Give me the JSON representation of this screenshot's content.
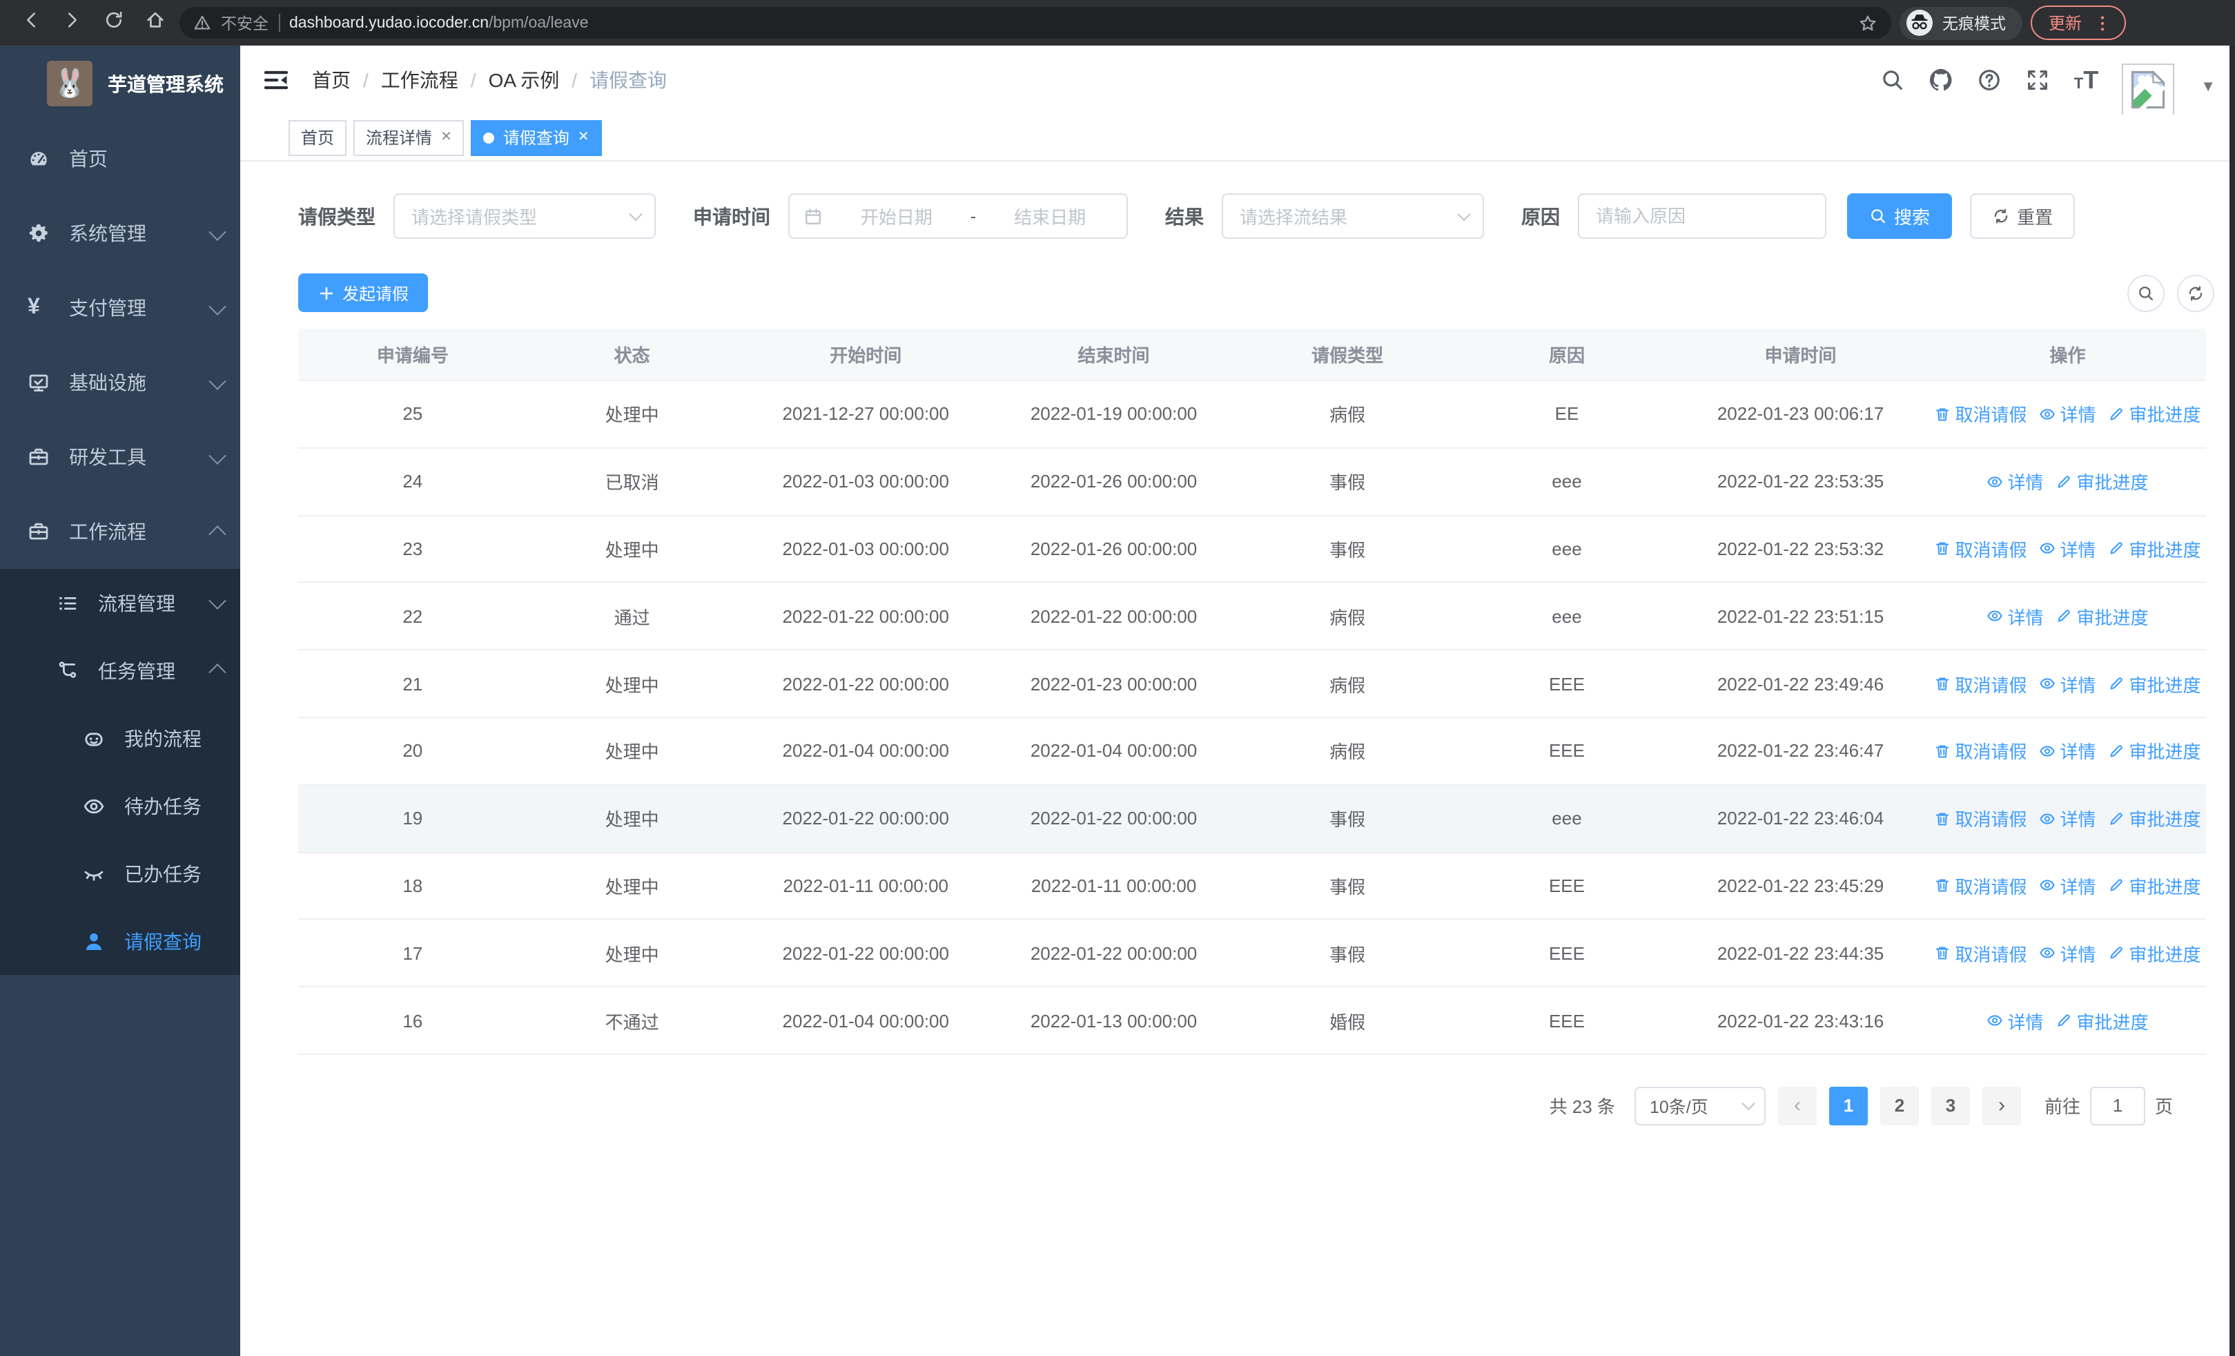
{
  "browser": {
    "security_label": "不安全",
    "url_host": "dashboard.yudao.iocoder.cn",
    "url_path": "/bpm/oa/leave",
    "incognito_label": "无痕模式",
    "update_label": "更新"
  },
  "sidebar": {
    "logo_title": "芋道管理系统",
    "menu": [
      {
        "label": "首页"
      },
      {
        "label": "系统管理"
      },
      {
        "label": "支付管理"
      },
      {
        "label": "基础设施"
      },
      {
        "label": "研发工具"
      },
      {
        "label": "工作流程"
      }
    ],
    "submenu": [
      {
        "label": "流程管理"
      },
      {
        "label": "任务管理"
      }
    ],
    "task_children": [
      {
        "label": "我的流程"
      },
      {
        "label": "待办任务"
      },
      {
        "label": "已办任务"
      },
      {
        "label": "请假查询"
      }
    ]
  },
  "navbar": {
    "breadcrumb": [
      "首页",
      "工作流程",
      "OA 示例",
      "请假查询"
    ]
  },
  "tags": [
    {
      "label": "首页"
    },
    {
      "label": "流程详情"
    },
    {
      "label": "请假查询"
    }
  ],
  "filters": {
    "leave_type_label": "请假类型",
    "leave_type_placeholder": "请选择请假类型",
    "apply_time_label": "申请时间",
    "date_start_placeholder": "开始日期",
    "date_separator": "-",
    "date_end_placeholder": "结束日期",
    "result_label": "结果",
    "result_placeholder": "请选择流结果",
    "reason_label": "原因",
    "reason_placeholder": "请输入原因",
    "search_label": "搜索",
    "reset_label": "重置",
    "create_label": "发起请假"
  },
  "table": {
    "headers": [
      "申请编号",
      "状态",
      "开始时间",
      "结束时间",
      "请假类型",
      "原因",
      "申请时间",
      "操作"
    ],
    "action_labels": {
      "cancel": "取消请假",
      "detail": "详情",
      "progress": "审批进度"
    },
    "rows": [
      {
        "id": "25",
        "status": "处理中",
        "start": "2021-12-27 00:00:00",
        "end": "2022-01-19 00:00:00",
        "type": "病假",
        "reason": "EE",
        "apply_time": "2022-01-23 00:06:17",
        "actions": [
          "cancel",
          "detail",
          "progress"
        ]
      },
      {
        "id": "24",
        "status": "已取消",
        "start": "2022-01-03 00:00:00",
        "end": "2022-01-26 00:00:00",
        "type": "事假",
        "reason": "eee",
        "apply_time": "2022-01-22 23:53:35",
        "actions": [
          "detail",
          "progress"
        ]
      },
      {
        "id": "23",
        "status": "处理中",
        "start": "2022-01-03 00:00:00",
        "end": "2022-01-26 00:00:00",
        "type": "事假",
        "reason": "eee",
        "apply_time": "2022-01-22 23:53:32",
        "actions": [
          "cancel",
          "detail",
          "progress"
        ]
      },
      {
        "id": "22",
        "status": "通过",
        "start": "2022-01-22 00:00:00",
        "end": "2022-01-22 00:00:00",
        "type": "病假",
        "reason": "eee",
        "apply_time": "2022-01-22 23:51:15",
        "actions": [
          "detail",
          "progress"
        ]
      },
      {
        "id": "21",
        "status": "处理中",
        "start": "2022-01-22 00:00:00",
        "end": "2022-01-23 00:00:00",
        "type": "病假",
        "reason": "EEE",
        "apply_time": "2022-01-22 23:49:46",
        "actions": [
          "cancel",
          "detail",
          "progress"
        ]
      },
      {
        "id": "20",
        "status": "处理中",
        "start": "2022-01-04 00:00:00",
        "end": "2022-01-04 00:00:00",
        "type": "病假",
        "reason": "EEE",
        "apply_time": "2022-01-22 23:46:47",
        "actions": [
          "cancel",
          "detail",
          "progress"
        ]
      },
      {
        "id": "19",
        "status": "处理中",
        "start": "2022-01-22 00:00:00",
        "end": "2022-01-22 00:00:00",
        "type": "事假",
        "reason": "eee",
        "apply_time": "2022-01-22 23:46:04",
        "actions": [
          "cancel",
          "detail",
          "progress"
        ],
        "highlighted": true
      },
      {
        "id": "18",
        "status": "处理中",
        "start": "2022-01-11 00:00:00",
        "end": "2022-01-11 00:00:00",
        "type": "事假",
        "reason": "EEE",
        "apply_time": "2022-01-22 23:45:29",
        "actions": [
          "cancel",
          "detail",
          "progress"
        ]
      },
      {
        "id": "17",
        "status": "处理中",
        "start": "2022-01-22 00:00:00",
        "end": "2022-01-22 00:00:00",
        "type": "事假",
        "reason": "EEE",
        "apply_time": "2022-01-22 23:44:35",
        "actions": [
          "cancel",
          "detail",
          "progress"
        ]
      },
      {
        "id": "16",
        "status": "不通过",
        "start": "2022-01-04 00:00:00",
        "end": "2022-01-13 00:00:00",
        "type": "婚假",
        "reason": "EEE",
        "apply_time": "2022-01-22 23:43:16",
        "actions": [
          "detail",
          "progress"
        ]
      }
    ]
  },
  "pagination": {
    "total_label": "共 23 条",
    "page_size": "10条/页",
    "pages": [
      "1",
      "2",
      "3"
    ],
    "active_page": "1",
    "prev_symbol": "‹",
    "next_symbol": "›",
    "goto_label": "前往",
    "goto_value": "1",
    "page_unit": "页"
  },
  "colors": {
    "primary": "#409eff",
    "sidebar_bg": "#304156",
    "submenu_bg": "#1f2d3d"
  }
}
